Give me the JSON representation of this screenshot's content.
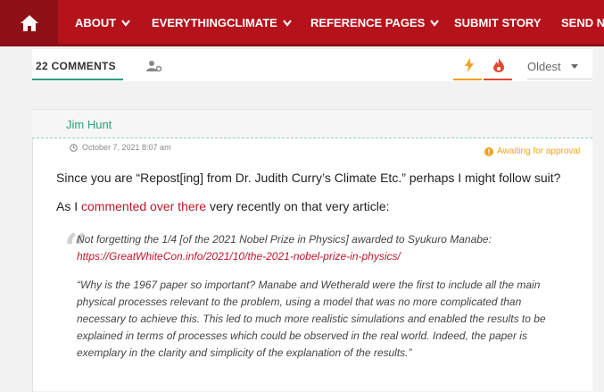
{
  "nav": {
    "items": [
      {
        "label": "ABOUT",
        "has_dropdown": true
      },
      {
        "label": "EVERYTHINGCLIMATE",
        "has_dropdown": true
      },
      {
        "label": "REFERENCE PAGES",
        "has_dropdown": true
      },
      {
        "label": "SUBMIT STORY",
        "has_dropdown": false
      },
      {
        "label": "SEND N",
        "has_dropdown": false
      }
    ],
    "home_icon": "home-icon",
    "color": "#b5121b"
  },
  "toolbar": {
    "comments_count": "22 COMMENTS",
    "sort_label": "Oldest",
    "people_icon": "user-settings-icon",
    "bolt_icon": "bolt-icon",
    "flame_icon": "flame-icon"
  },
  "comment": {
    "author": "Jim Hunt",
    "timestamp": "October 7, 2021 8:07 am",
    "status": "Awaiting for approval",
    "para1": "Since you are “Repost[ing] from Dr. Judith Curry’s Climate Etc.” perhaps I might follow suit?",
    "para2_prefix": "As I ",
    "para2_link": "commented over there",
    "para2_suffix": " very recently on that very article:",
    "quote": {
      "line1": "Not forgetting the 1/4 [of the 2021 Nobel Prize in Physics] awarded to Syukuro Manabe:",
      "link": "https://GreatWhiteCon.info/2021/10/the-2021-nobel-prize-in-physics/",
      "body": "“Why is the 1967 paper so important? Manabe and Wetherald were the first to include all the main physical processes relevant to the problem, using a model that was no more complicated than necessary to achieve this. This led to much more realistic simulations and enabled the results to be explained in terms of processes which could be observed in the real world. Indeed, the paper is exemplary in the clarity and simplicity of the explanation of the results.”"
    }
  },
  "colors": {
    "accent_green": "#2d9e7a",
    "link_red": "#c0162a",
    "warning_orange": "#f0a21e"
  }
}
